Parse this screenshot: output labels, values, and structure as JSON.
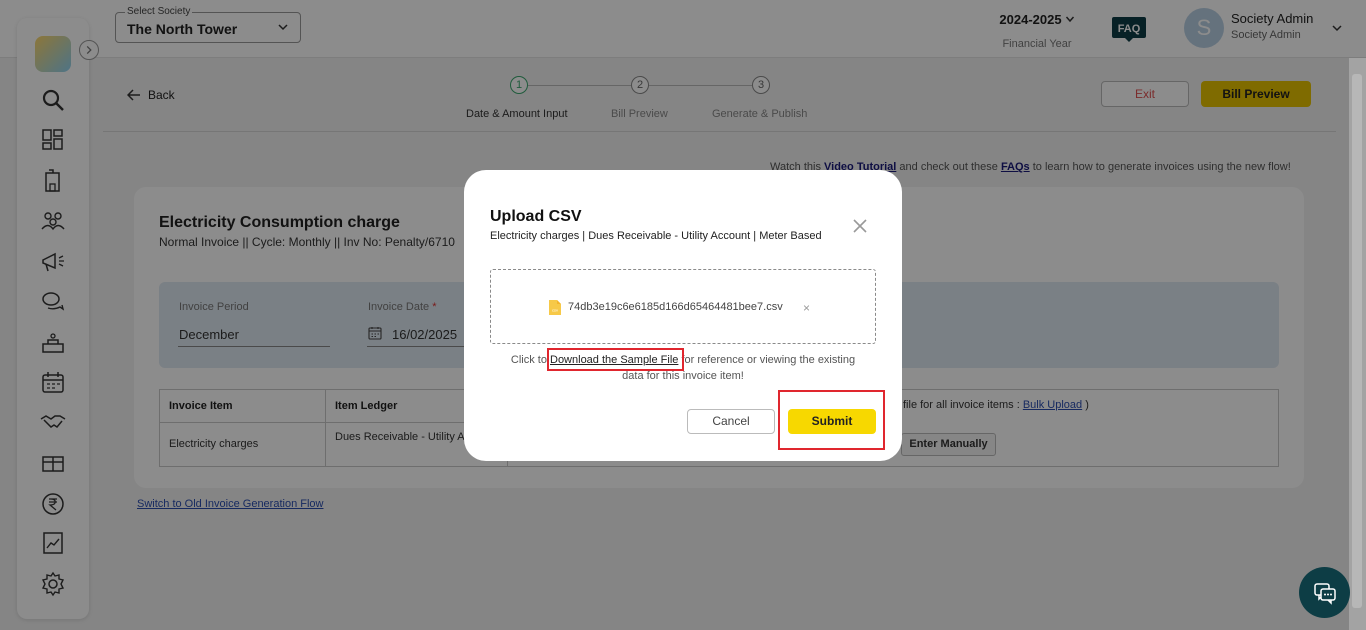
{
  "topbar": {
    "society_label": "Select Society",
    "society_value": "The North Tower",
    "financial_year": "2024-2025",
    "financial_year_label": "Financial Year",
    "faq_badge": "FAQ",
    "user_initial": "S",
    "user_name": "Society Admin",
    "user_role": "Society Admin"
  },
  "sidebar": {
    "items": [
      "search-icon",
      "dashboard-icon",
      "building-icon",
      "members-icon",
      "announcement-icon",
      "chat-bubbles-icon",
      "helpdesk-icon",
      "calendar-icon",
      "handshake-icon",
      "gift-icon",
      "rupee-icon",
      "report-icon",
      "settings-icon"
    ]
  },
  "header": {
    "back_label": "Back",
    "steps": [
      {
        "num": "1",
        "label": "Date & Amount Input",
        "active": true
      },
      {
        "num": "2",
        "label": "Bill Preview",
        "active": false
      },
      {
        "num": "3",
        "label": "Generate & Publish",
        "active": false
      }
    ],
    "exit_label": "Exit",
    "bill_preview_label": "Bill Preview"
  },
  "help": {
    "prefix": "Watch this",
    "video_link": "Video Tutorial",
    "middle": "and check out these",
    "faq_link": "FAQs",
    "suffix": "to learn how to generate invoices using the new flow!"
  },
  "invoice": {
    "title": "Electricity Consumption charge",
    "subtitle": "Normal Invoice || Cycle: Monthly || Inv No: Penalty/6710",
    "period_label": "Invoice Period",
    "period_value": "December",
    "date_label": "Invoice Date",
    "date_required": "*",
    "date_value": "16/02/2025",
    "table": {
      "headers": [
        "Invoice Item",
        "Item Ledger"
      ],
      "row": {
        "item": "Electricity charges",
        "ledger": "Dues Receivable - Utility Account"
      }
    },
    "bulk_text": "file for all invoice items :",
    "bulk_link": "Bulk Upload",
    "bulk_close": ")",
    "enter_manually": "Enter Manually"
  },
  "switch_link": "Switch to Old Invoice Generation Flow",
  "modal": {
    "title": "Upload CSV",
    "subtitle": "Electricity charges | Dues Receivable - Utility Account | Meter Based",
    "file_name": "74db3e19c6e6185d166d65464481bee7.csv",
    "file_remove": "×",
    "help_prefix": "Click to",
    "download_link": "Download the Sample File",
    "help_suffix": "for reference or viewing the existing data for this invoice item!",
    "cancel_label": "Cancel",
    "submit_label": "Submit"
  },
  "colors": {
    "accent_yellow": "#f7d800",
    "highlight_red": "#e0262e",
    "active_step_green": "#3aa76d"
  }
}
